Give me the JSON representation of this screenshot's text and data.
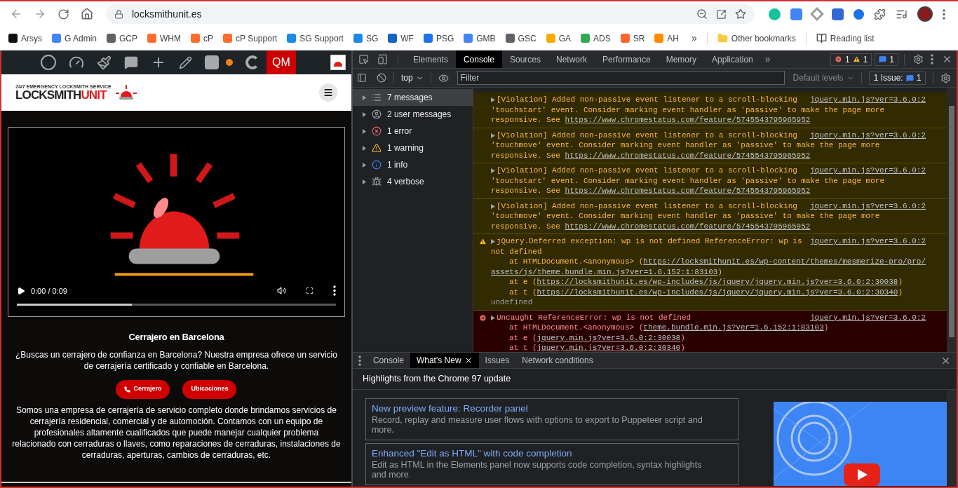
{
  "browser": {
    "address": "locksmithunit.es",
    "bookmarks": [
      {
        "label": "Arsys",
        "color": "#111111"
      },
      {
        "label": "G Admin",
        "color": "#4285f4"
      },
      {
        "label": "GCP",
        "color": "#5f6368"
      },
      {
        "label": "WHM",
        "color": "#ff6c2c"
      },
      {
        "label": "cP",
        "color": "#ff6c2c"
      },
      {
        "label": "cP Support",
        "color": "#ff6c2c"
      },
      {
        "label": "SG Support",
        "color": "#1e88e5"
      },
      {
        "label": "SG",
        "color": "#1e88e5"
      },
      {
        "label": "WF",
        "color": "#1565c0"
      },
      {
        "label": "PSG",
        "color": "#1a73e8"
      },
      {
        "label": "GMB",
        "color": "#4285f4"
      },
      {
        "label": "GSC",
        "color": "#5f6368"
      },
      {
        "label": "GA",
        "color": "#f9ab00"
      },
      {
        "label": "ADS",
        "color": "#34a853"
      },
      {
        "label": "SR",
        "color": "#ff642d"
      },
      {
        "label": "AH",
        "color": "#ff8c00"
      }
    ],
    "more": "»",
    "other_bookmarks": "Other bookmarks",
    "reading_list": "Reading list"
  },
  "admin_bar": {
    "qm": "QM"
  },
  "site": {
    "logo": {
      "tagline": "24/7 EMERGENCY LOCKSMITH SERVICE",
      "name": "LOCKSMITH",
      "accent": "UNIT"
    },
    "video": {
      "time": "0:00 / 0:09",
      "level": 0.36
    },
    "heading": "Cerrajero en Barcelona",
    "intro": "¿Buscas un cerrajero de confianza en Barcelona? Nuestra empresa ofrece un servicio de cerrajería certificado y confiable en Barcelona.",
    "buttons": [
      {
        "label": "Cerrajero",
        "kind": "phone"
      },
      {
        "label": "Ubicaciones",
        "kind": "plain"
      }
    ],
    "body": "Somos una empresa de cerrajería de servicio completo donde brindamos servicios de cerrajería residencial, comercial y de automoción. Contamos con un equipo de profesionales altamente cualificados que puede manejar cualquier problema relacionado con cerraduras o llaves, como reparaciones de cerraduras, instalaciones de cerraduras, aperturas, cambios de cerraduras, etc."
  },
  "devtools": {
    "tabs": [
      {
        "label": "Elements",
        "selected": false
      },
      {
        "label": "Console",
        "selected": true
      },
      {
        "label": "Sources",
        "selected": false
      },
      {
        "label": "Network",
        "selected": false
      },
      {
        "label": "Performance",
        "selected": false
      },
      {
        "label": "Memory",
        "selected": false
      },
      {
        "label": "Application",
        "selected": false
      }
    ],
    "more_tabs": "»",
    "errors": "1",
    "warnings": "1",
    "infos": "1",
    "context": "top",
    "filter": {
      "placeholder": "Filter"
    },
    "levels": "Default levels",
    "issues": {
      "label": "1 Issue:",
      "count": "1"
    },
    "sidebar": [
      {
        "label": "7 messages",
        "kind": "all",
        "selected": true
      },
      {
        "label": "2 user messages",
        "kind": "user",
        "selected": false
      },
      {
        "label": "1 error",
        "kind": "error",
        "selected": false
      },
      {
        "label": "1 warning",
        "kind": "warning",
        "selected": false
      },
      {
        "label": "1 info",
        "kind": "info",
        "selected": false
      },
      {
        "label": "4 verbose",
        "kind": "verbose",
        "selected": false
      }
    ],
    "messages": [
      {
        "kind": "violation",
        "source": "jquery.min.js?ver=3.6.0:2",
        "lines": [
          {
            "kind": "head",
            "parts": [
              {
                "kind": "text",
                "text": "[Violation] Added non-passive event listener to a scroll-blocking"
              }
            ]
          },
          {
            "kind": "wrap",
            "parts": [
              {
                "kind": "text",
                "text": "'touchstart' event. Consider marking event handler as 'passive' to make the page more"
              }
            ]
          },
          {
            "kind": "wrap",
            "parts": [
              {
                "kind": "text",
                "text": "responsive. See"
              },
              {
                "kind": "link",
                "text": "https://www.chromestatus.com/feature/5745543795965952"
              }
            ]
          }
        ]
      },
      {
        "kind": "violation",
        "source": "jquery.min.js?ver=3.6.0:2",
        "lines": [
          {
            "kind": "head",
            "parts": [
              {
                "kind": "text",
                "text": "[Violation] Added non-passive event listener to a scroll-blocking"
              }
            ]
          },
          {
            "kind": "wrap",
            "parts": [
              {
                "kind": "text",
                "text": "'touchmove' event. Consider marking event handler as 'passive' to make the page more"
              }
            ]
          },
          {
            "kind": "wrap",
            "parts": [
              {
                "kind": "text",
                "text": "responsive. See"
              },
              {
                "kind": "link",
                "text": "https://www.chromestatus.com/feature/5745543795965952"
              }
            ]
          }
        ]
      },
      {
        "kind": "violation",
        "source": "jquery.min.js?ver=3.6.0:2",
        "lines": [
          {
            "kind": "head",
            "parts": [
              {
                "kind": "text",
                "text": "[Violation] Added non-passive event listener to a scroll-blocking"
              }
            ]
          },
          {
            "kind": "wrap",
            "parts": [
              {
                "kind": "text",
                "text": "'touchstart' event. Consider marking event handler as 'passive' to make the page more"
              }
            ]
          },
          {
            "kind": "wrap",
            "parts": [
              {
                "kind": "text",
                "text": "responsive. See"
              },
              {
                "kind": "link",
                "text": "https://www.chromestatus.com/feature/5745543795965952"
              }
            ]
          }
        ]
      },
      {
        "kind": "violation",
        "source": "jquery.min.js?ver=3.6.0:2",
        "lines": [
          {
            "kind": "head",
            "parts": [
              {
                "kind": "text",
                "text": "[Violation] Added non-passive event listener to a scroll-blocking"
              }
            ]
          },
          {
            "kind": "wrap",
            "parts": [
              {
                "kind": "text",
                "text": "'touchmove' event. Consider marking event handler as 'passive' to make the page more"
              }
            ]
          },
          {
            "kind": "wrap",
            "parts": [
              {
                "kind": "text",
                "text": "responsive. See"
              },
              {
                "kind": "link",
                "text": "https://www.chromestatus.com/feature/5745543795965952"
              }
            ]
          }
        ]
      },
      {
        "kind": "warning",
        "source": "jquery.min.js?ver=3.6.0:2",
        "lines": [
          {
            "kind": "head",
            "parts": [
              {
                "kind": "text",
                "text": "jQuery.Deferred exception: wp is not defined ReferenceError: wp is"
              }
            ]
          },
          {
            "kind": "wrap",
            "parts": [
              {
                "kind": "text",
                "text": "not defined"
              }
            ]
          },
          {
            "kind": "stack",
            "parts": [
              {
                "kind": "text",
                "text": "at HTMLDocument.<anonymous> ("
              },
              {
                "kind": "link",
                "text": "https://locksmithunit.es/wp-content/themes/mesmerize-pro/pro/"
              }
            ]
          },
          {
            "kind": "wrap",
            "parts": [
              {
                "kind": "link",
                "text": "assets/js/theme.bundle.min.js?ver=1.6.152:1:83103"
              },
              {
                "kind": "text",
                "text": ")"
              }
            ]
          },
          {
            "kind": "stack",
            "parts": [
              {
                "kind": "text",
                "text": "at e ("
              },
              {
                "kind": "link",
                "text": "https://locksmithunit.es/wp-includes/js/jquery/jquery.min.js?ver=3.6.0:2:30038"
              },
              {
                "kind": "text",
                "text": ")"
              }
            ]
          },
          {
            "kind": "stack",
            "parts": [
              {
                "kind": "text",
                "text": "at t ("
              },
              {
                "kind": "link",
                "text": "https://locksmithunit.es/wp-includes/js/jquery/jquery.min.js?ver=3.6.0:2:30340"
              },
              {
                "kind": "text",
                "text": ")"
              }
            ]
          },
          {
            "kind": "wrap",
            "parts": [
              {
                "kind": "dim",
                "text": "undefined"
              }
            ]
          }
        ]
      },
      {
        "kind": "error",
        "source": "jquery.min.js?ver=3.6.0:2",
        "lines": [
          {
            "kind": "head",
            "parts": [
              {
                "kind": "text",
                "text": "Uncaught ReferenceError: wp is not defined"
              }
            ]
          },
          {
            "kind": "stack",
            "parts": [
              {
                "kind": "text",
                "text": "at HTMLDocument.<anonymous> ("
              },
              {
                "kind": "link",
                "text": "theme.bundle.min.js?ver=1.6.152:1:83103"
              },
              {
                "kind": "text",
                "text": ")"
              }
            ]
          },
          {
            "kind": "stack",
            "parts": [
              {
                "kind": "text",
                "text": "at e ("
              },
              {
                "kind": "link",
                "text": "jquery.min.js?ver=3.6.0:2:30038"
              },
              {
                "kind": "text",
                "text": ")"
              }
            ]
          },
          {
            "kind": "stack",
            "parts": [
              {
                "kind": "text",
                "text": "at t ("
              },
              {
                "kind": "link",
                "text": "jquery.min.js?ver=3.6.0:2:30340"
              },
              {
                "kind": "text",
                "text": ")"
              }
            ]
          }
        ]
      }
    ],
    "drawer": {
      "tabs": [
        {
          "label": "Console",
          "selected": false,
          "closable": false
        },
        {
          "label": "What's New",
          "selected": true,
          "closable": true
        },
        {
          "label": "Issues",
          "selected": false,
          "closable": false
        },
        {
          "label": "Network conditions",
          "selected": false,
          "closable": false
        }
      ],
      "heading": "Highlights from the Chrome 97 update",
      "cards": [
        {
          "title": "New preview feature: Recorder panel",
          "text": "Record, replay and measure user flows with options to export to Puppeteer script and more."
        },
        {
          "title": "Enhanced \"Edit as HTML\" with code completion",
          "text": "Edit as HTML in the Elements panel now supports code completion, syntax highlights and more."
        }
      ]
    }
  }
}
